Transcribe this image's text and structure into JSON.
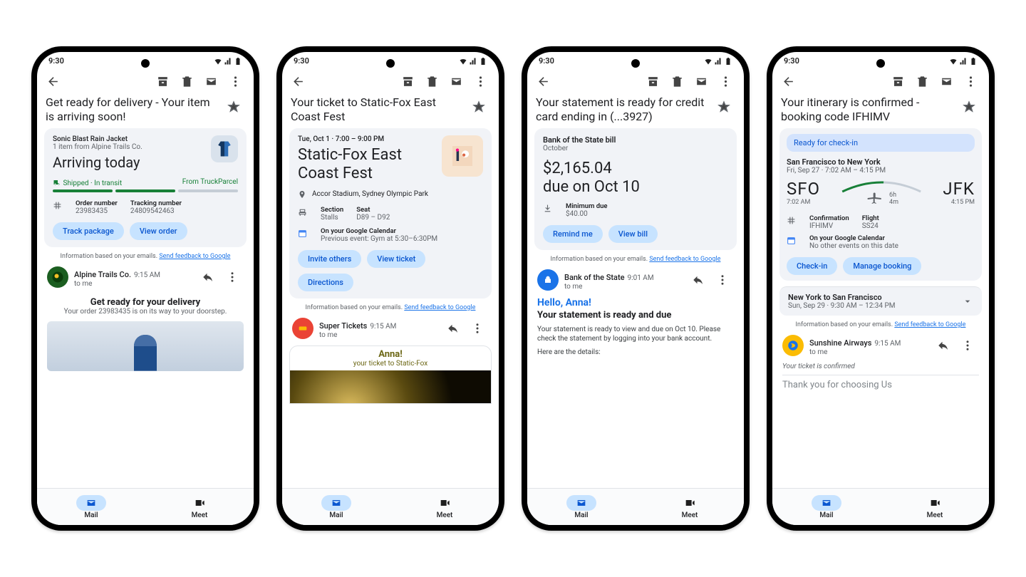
{
  "status_time": "9:30",
  "bottom_nav": {
    "mail": "Mail",
    "meet": "Meet"
  },
  "feedback": {
    "prefix": "Information based on your emails. ",
    "link": "Send feedback to Google"
  },
  "phone1": {
    "subject": "Get ready for delivery - Your item is arriving soon!",
    "product": "Sonic Blast Rain Jacket",
    "from_vendor": "1 item from Alpine Trails Co.",
    "headline": "Arriving today",
    "prog_left": "Shipped · In transit",
    "prog_right": "From TruckParcel",
    "order_k": "Order number",
    "order_v": "23983435",
    "track_k": "Tracking number",
    "track_v": "24809542463",
    "btn1": "Track package",
    "btn2": "View order",
    "sender": "Alpine Trails Co.",
    "sender_time": "9:15 AM",
    "to": "to me",
    "body_h": "Get ready for your delivery",
    "body_s": "Your order 23983435 is on its way to your doorstep."
  },
  "phone2": {
    "subject": "Your ticket to Static-Fox East Coast Fest",
    "datetime": "Tue, Oct 1 · 7:00 – 9:00 PM",
    "event": "Static-Fox East Coast Fest",
    "venue": "Accor Stadium, Sydney Olympic Park",
    "section_k": "Section",
    "section_v": "Stalls",
    "seat_k": "Seat",
    "seat_v": "D89 – D92",
    "cal_k": "On your Google Calendar",
    "cal_v": "Previous event: Gym at 5:30–6:30PM",
    "btn1": "Invite others",
    "btn2": "View ticket",
    "btn3": "Directions",
    "sender": "Super Tickets",
    "sender_time": "9:15 AM",
    "to": "to me",
    "body_name": "Anna!",
    "body_sub": "your ticket to Static-Fox"
  },
  "phone3": {
    "subject": "Your statement is ready for credit card ending in (...3927)",
    "bill_name": "Bank of the State bill",
    "bill_period": "October",
    "amount": "$2,165.04",
    "due": "due on Oct 10",
    "min_k": "Minimum due",
    "min_v": "$40.00",
    "btn1": "Remind me",
    "btn2": "View bill",
    "sender": "Bank of the State",
    "sender_time": "9:01 AM",
    "to": "to me",
    "hello": "Hello, Anna!",
    "h2": "Your statement is ready and due",
    "p": "Your statement is ready to view and due on Oct 10. Please check the statement by logging into your bank account.",
    "p2": "Here are the details:"
  },
  "phone4": {
    "subject": "Your itinerary is confirmed - booking code IFHIMV",
    "banner": "Ready for check-in",
    "seg1_t": "San Francisco to New York",
    "seg1_s": "Fri, Sep 27 · 7:02 AM – 4:15 PM",
    "dep": "SFO",
    "dep_t": "7:02 AM",
    "arr": "JFK",
    "arr_t": "4:15 PM",
    "dur": "6h 4m",
    "conf_k": "Confirmation",
    "conf_v": "IFHIMV",
    "flight_k": "Flight",
    "flight_v": "SS24",
    "cal_k": "On your Google Calendar",
    "cal_v": "No other events on this date",
    "btn1": "Check-in",
    "btn2": "Manage booking",
    "seg2_t": "New York to San Francisco",
    "seg2_s": "Sun, Sep 29 · 9:30 AM – 12:34 PM",
    "sender": "Sunshine Airways",
    "sender_time": "9:15 AM",
    "to": "to me",
    "body_line": "Your ticket is confirmed",
    "body_cut": "Thank you for choosing Us"
  }
}
